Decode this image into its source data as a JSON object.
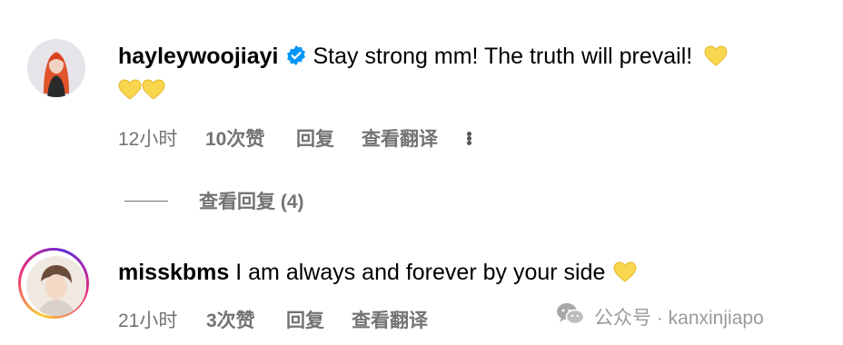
{
  "comments": [
    {
      "username": "hayleywoojiayi",
      "verified": true,
      "text": "Stay strong mm! The truth will prevail!",
      "time": "12小时",
      "likes": "10次赞",
      "reply": "回复",
      "translate": "查看翻译",
      "more_icon": "more-dots-icon",
      "view_replies": "查看回复 (4)"
    },
    {
      "username": "misskbms",
      "verified": false,
      "text": "I am always and forever by your side",
      "time": "21小时",
      "likes": "3次赞",
      "reply": "回复",
      "translate": "查看翻译"
    }
  ],
  "watermark": {
    "icon": "wechat-icon",
    "text": "公众号 · kanxinjiapo"
  },
  "colors": {
    "heart": "#f8d64e",
    "verified": "#0095f6",
    "muted": "#737373"
  }
}
